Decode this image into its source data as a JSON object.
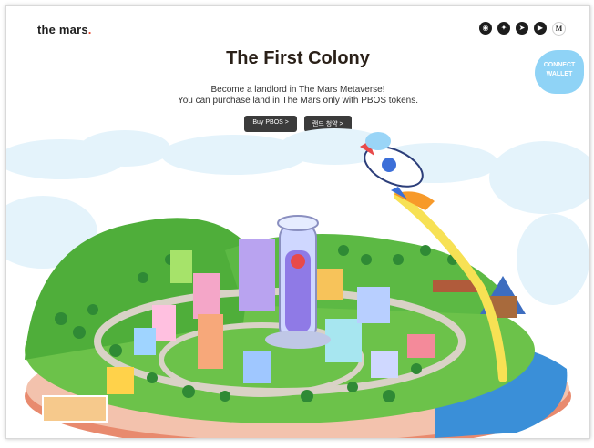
{
  "header": {
    "logo_text": "the mars",
    "logo_dot": ".",
    "socials": [
      {
        "name": "discord-icon",
        "glyph": "◉"
      },
      {
        "name": "twitter-icon",
        "glyph": "✦"
      },
      {
        "name": "telegram-icon",
        "glyph": "➤"
      },
      {
        "name": "youtube-icon",
        "glyph": "▶"
      },
      {
        "name": "medium-icon",
        "glyph": "M"
      }
    ],
    "connect_wallet_label": "CONNECT WALLET"
  },
  "hero": {
    "title": "The First Colony",
    "subtitle_line1": "Become a landlord in The Mars Metaverse!",
    "subtitle_line2": "You can purchase land in The Mars only with PBOS tokens.",
    "buy_button": "Buy PBOS >",
    "land_button": "랜드 청약 >"
  },
  "colors": {
    "accent": "#8fd3f6",
    "grass": "#6cc24a",
    "sea": "#3a8fd8",
    "button": "#3b3b3b"
  }
}
